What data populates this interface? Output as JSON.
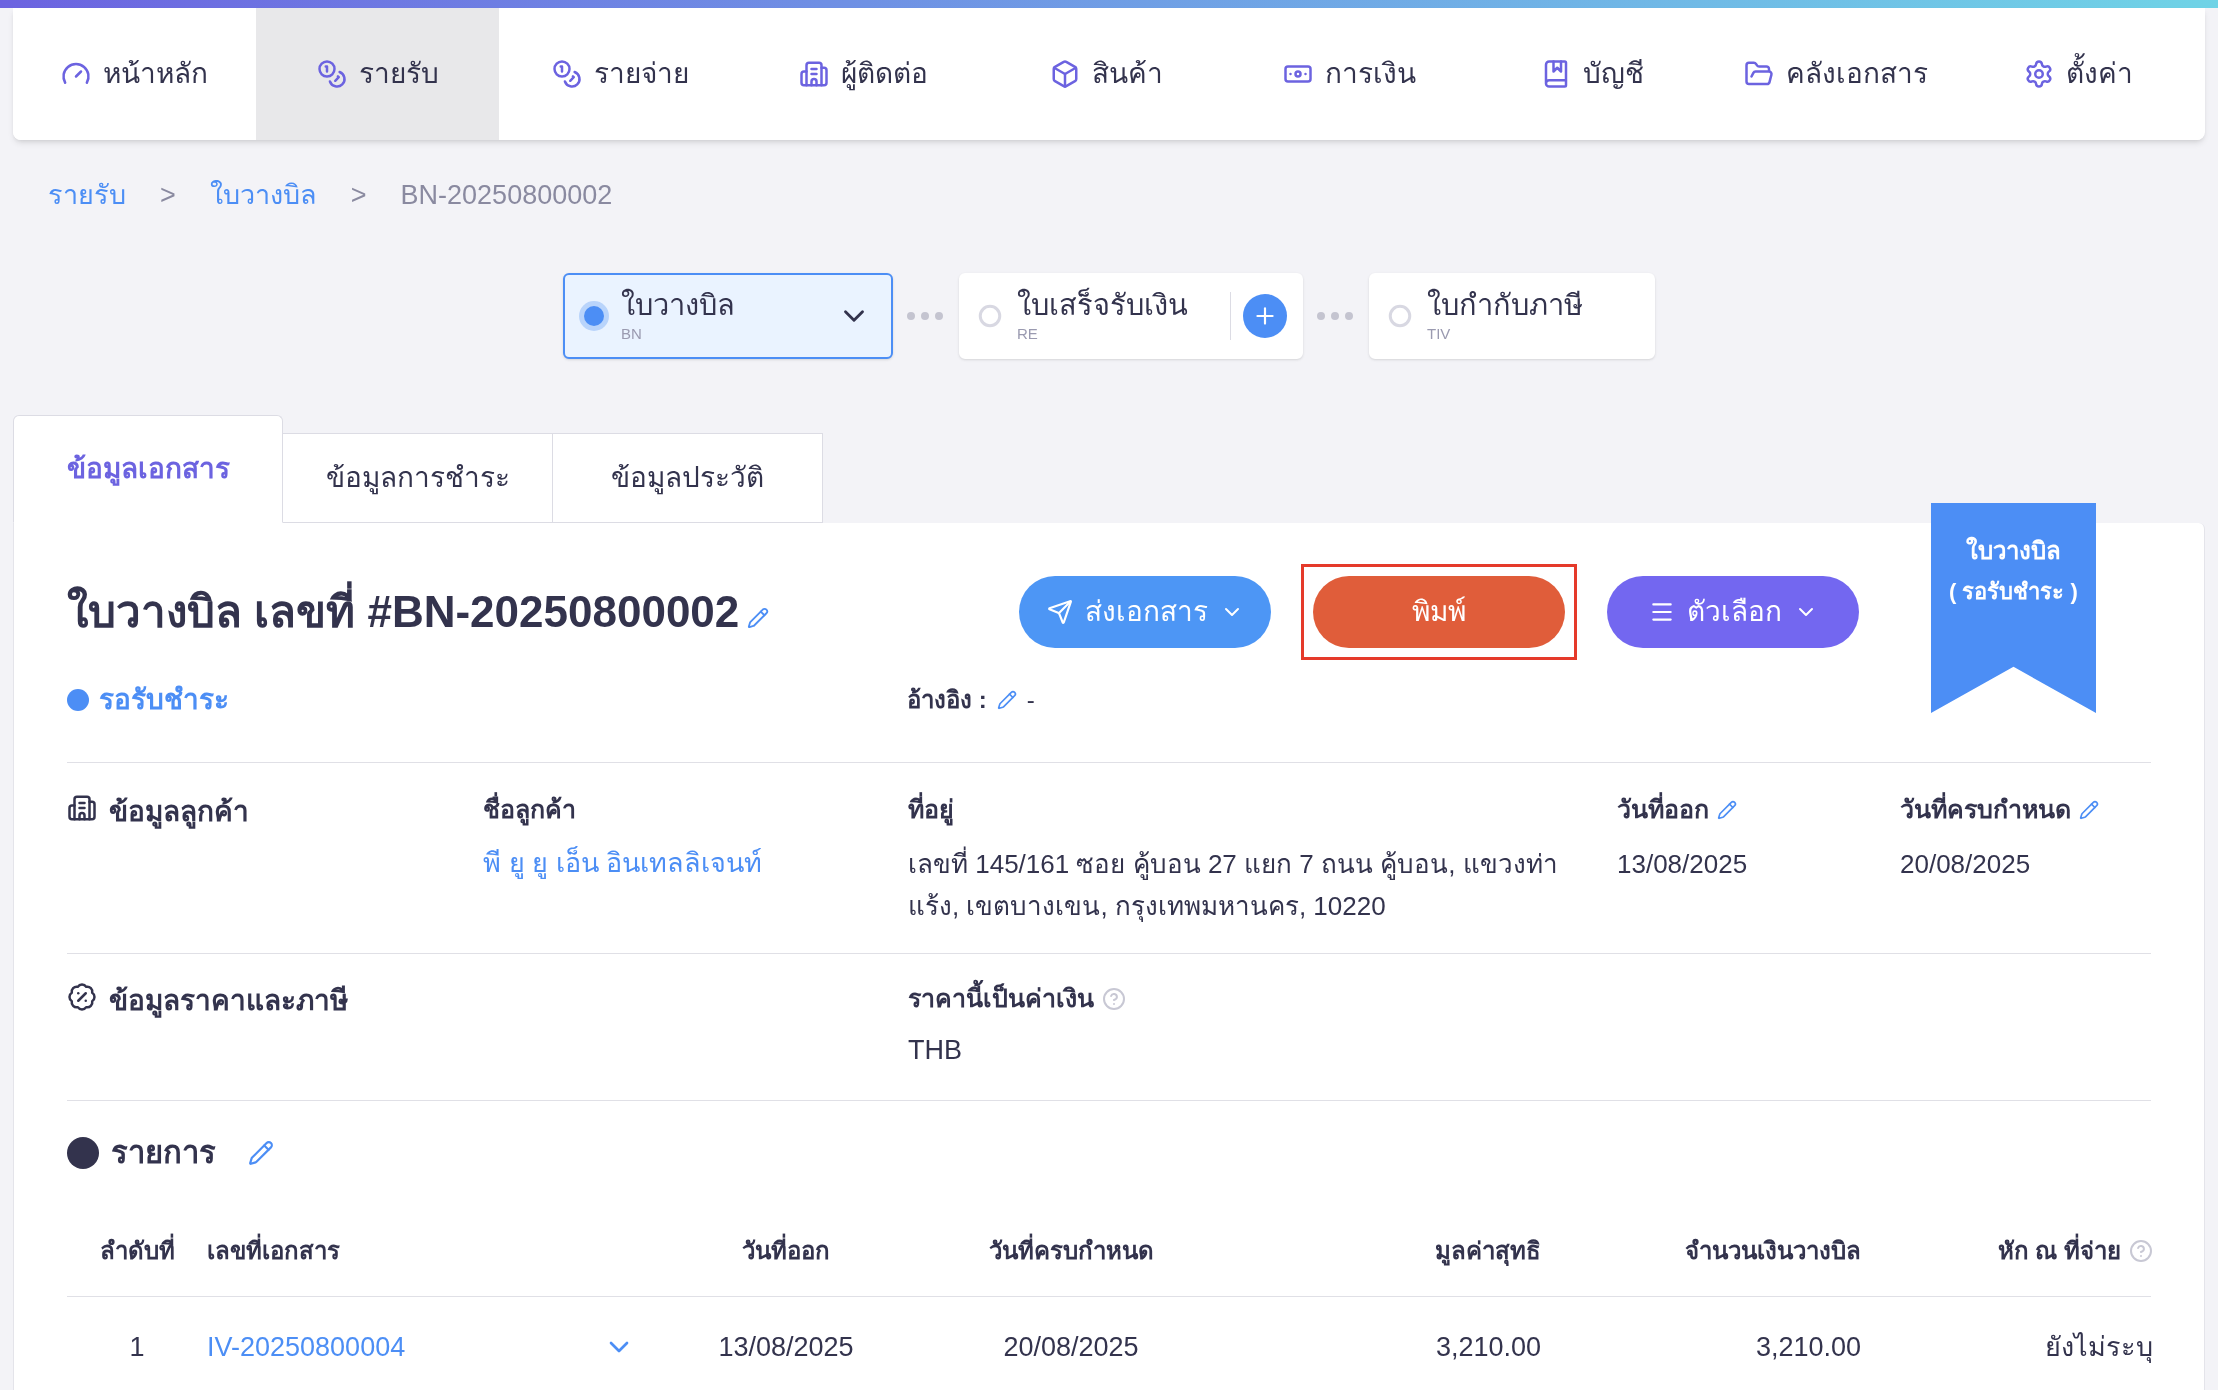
{
  "nav": [
    {
      "label": "หน้าหลัก",
      "selected": false
    },
    {
      "label": "รายรับ",
      "selected": true
    },
    {
      "label": "รายจ่าย",
      "selected": false
    },
    {
      "label": "ผู้ติดต่อ",
      "selected": false
    },
    {
      "label": "สินค้า",
      "selected": false
    },
    {
      "label": "การเงิน",
      "selected": false
    },
    {
      "label": "บัญชี",
      "selected": false
    },
    {
      "label": "คลังเอกสาร",
      "selected": false
    },
    {
      "label": "ตั้งค่า",
      "selected": false
    }
  ],
  "breadcrumb": [
    {
      "text": "รายรับ",
      "kind": "link"
    },
    {
      "text": ">",
      "kind": "separator"
    },
    {
      "text": "ใบวางบิล",
      "kind": "link"
    },
    {
      "text": ">",
      "kind": "separator"
    },
    {
      "text": "BN-20250800002",
      "kind": "current"
    }
  ],
  "steps": [
    {
      "title": "ใบวางบิล",
      "code": "BN",
      "selected": true,
      "kind": "dropdown"
    },
    {
      "title": "ใบเสร็จรับเงิน",
      "code": "RE",
      "selected": false,
      "kind": "add"
    },
    {
      "title": "ใบกำกับภาษี",
      "code": "TIV",
      "selected": false,
      "kind": "plain"
    }
  ],
  "tabs": [
    {
      "label": "ข้อมูลเอกสาร",
      "selected": true
    },
    {
      "label": "ข้อมูลการชำระ",
      "selected": false
    },
    {
      "label": "ข้อมูลประวัติ",
      "selected": false
    }
  ],
  "document": {
    "title": "ใบวางบิล เลขที่ #BN-20250800002",
    "status": "รอรับชำระ",
    "reference_label": "อ้างอิง :",
    "reference_value": "-"
  },
  "buttons": [
    {
      "label": "ส่งเอกสาร",
      "kind": "send",
      "highlighted": false
    },
    {
      "label": "พิมพ์",
      "kind": "print",
      "highlighted": true
    },
    {
      "label": "ตัวเลือก",
      "kind": "options",
      "highlighted": false
    }
  ],
  "ribbon": {
    "line1": "ใบวางบิล",
    "line2": "( รอรับชำระ )"
  },
  "customer_section": {
    "heading": "ข้อมูลลูกค้า",
    "fields": [
      {
        "label": "ชื่อลูกค้า",
        "value": "พี ยู ยู เอ็น อินเทลลิเจนท์",
        "kind": "link",
        "editable": false
      },
      {
        "label": "ที่อยู่",
        "value": "เลขที่ 145/161 ซอย คู้บอน 27 แยก 7 ถนน คู้บอน, แขวงท่าแร้ง, เขตบางเขน, กรุงเทพมหานคร, 10220",
        "kind": "text",
        "editable": false
      },
      {
        "label": "วันที่ออก",
        "value": "13/08/2025",
        "kind": "text",
        "editable": true
      },
      {
        "label": "วันที่ครบกำหนด",
        "value": "20/08/2025",
        "kind": "text",
        "editable": true
      }
    ]
  },
  "price_section": {
    "heading": "ข้อมูลราคาและภาษี",
    "label": "ราคานี้เป็นค่าเงิน",
    "value": "THB"
  },
  "items": {
    "heading": "รายการ",
    "columns": [
      {
        "label": "ลำดับที่",
        "help": false
      },
      {
        "label": "เลขที่เอกสาร",
        "help": false
      },
      {
        "label": "วันที่ออก",
        "help": false
      },
      {
        "label": "วันที่ครบกำหนด",
        "help": false
      },
      {
        "label": "มูลค่าสุทธิ",
        "help": false
      },
      {
        "label": "จำนวนเงินวางบิล",
        "help": false
      },
      {
        "label": "หัก ณ ที่จ่าย",
        "help": true
      }
    ],
    "rows": [
      {
        "no": "1",
        "doc": "IV-20250800004",
        "issued": "13/08/2025",
        "due": "20/08/2025",
        "net": "3,210.00",
        "billed": "3,210.00",
        "withholding": "ยังไม่ระบุ",
        "expanded": false
      }
    ]
  }
}
